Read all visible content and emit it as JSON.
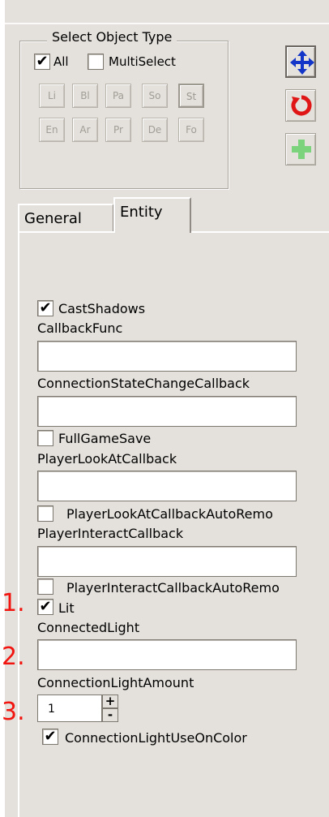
{
  "group": {
    "title": "Select Object Type",
    "all_label": "All",
    "all_checked": "✔",
    "multiselect_label": "MultiSelect",
    "multiselect_checked": "",
    "types": [
      "Li",
      "Bl",
      "Pa",
      "So",
      "St",
      "En",
      "Ar",
      "Pr",
      "De",
      "Fo"
    ],
    "active_type": "St"
  },
  "tools": [
    "move-arrows-icon",
    "rotate-icon",
    "add-plus-icon"
  ],
  "tabs": {
    "general": "General",
    "entity": "Entity",
    "active": "Entity"
  },
  "fields": {
    "cast_shadows_label": "CastShadows",
    "cast_shadows_checked": "✔",
    "callback_func_label": "CallbackFunc",
    "callback_func_value": "",
    "connection_state_label": "ConnectionStateChangeCallback",
    "connection_state_value": "",
    "full_game_save_label": "FullGameSave",
    "full_game_save_checked": "",
    "player_look_at_label": "PlayerLookAtCallback",
    "player_look_at_value": "",
    "player_look_at_auto_label": "PlayerLookAtCallbackAutoRemo",
    "player_look_at_auto_checked": "",
    "player_interact_label": "PlayerInteractCallback",
    "player_interact_value": "",
    "player_interact_auto_label": "PlayerInteractCallbackAutoRemo",
    "player_interact_auto_checked": "",
    "lit_label": "Lit",
    "lit_checked": "✔",
    "connected_light_label": "ConnectedLight",
    "connected_light_value": "",
    "connection_light_amount_label": "ConnectionLightAmount",
    "connection_light_amount_value": "1",
    "spin_up": "+",
    "spin_down": "-",
    "use_on_color_label": "ConnectionLightUseOnColor",
    "use_on_color_checked": "✔"
  },
  "annotations": [
    "1.",
    "2.",
    "3."
  ],
  "colors": {
    "panel": "#e4e1dc",
    "annotation": "#f2150f",
    "move_icon": "#1436c8",
    "rotate_icon": "#e01616",
    "plus_icon": "#7bd37b"
  }
}
